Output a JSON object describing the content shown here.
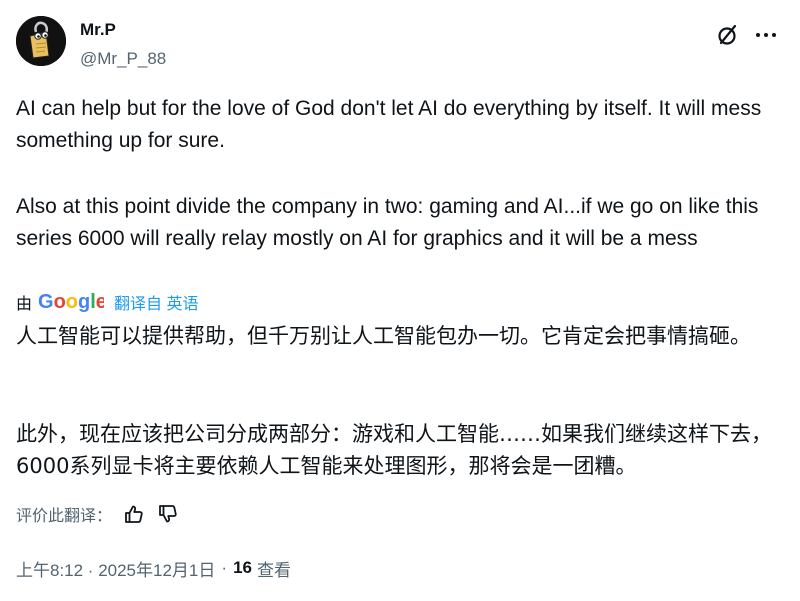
{
  "author": {
    "display_name": "Mr.P",
    "handle": "@Mr_P_88"
  },
  "tweet": {
    "paragraph_1": "AI can help but for the love of God don't let AI do everything by itself. It will mess something up for sure.",
    "paragraph_2": "Also at this point divide the company in two: gaming and AI...if we go on like this series 6000 will really relay mostly on AI for graphics and it will be a mess"
  },
  "translation": {
    "by_label": "由",
    "provider": "Google",
    "from_label": "翻译自 英语",
    "paragraph_1": "人工智能可以提供帮助，但千万别让人工智能包办一切。它肯定会把事情搞砸。",
    "paragraph_2": "此外，现在应该把公司分成两部分：游戏和人工智能……如果我们继续这样下去，6000系列显卡将主要依赖人工智能来处理图形，那将会是一团糟。",
    "rate_label": "评价此翻译："
  },
  "meta": {
    "time": "上午8:12 · 2025年12月1日",
    "separator": "·",
    "views_count": "16",
    "views_label": "查看"
  },
  "icons": {
    "grok": "grok-icon",
    "more": "more-icon",
    "thumbs_up": "thumbs-up-icon",
    "thumbs_down": "thumbs-down-icon"
  },
  "colors": {
    "text": "#0f1419",
    "secondary": "#536471",
    "link": "#1d9bf0"
  }
}
